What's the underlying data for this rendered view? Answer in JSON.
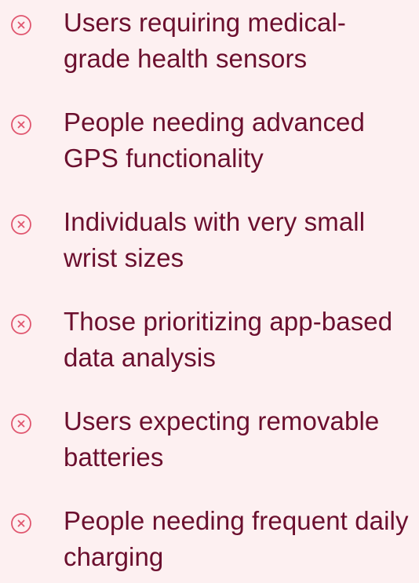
{
  "list": {
    "icon": "x-circle-icon",
    "icon_color": "#e0566f",
    "text_color": "#6b0f2e",
    "items": [
      {
        "line1": "Users requiring medical-",
        "line2": "grade health sensors"
      },
      {
        "line1": "People needing advanced",
        "line2": "GPS functionality"
      },
      {
        "line1": "Individuals with very small",
        "line2": "wrist sizes"
      },
      {
        "line1": "Those prioritizing app-based",
        "line2": "data analysis"
      },
      {
        "line1": "Users expecting removable",
        "line2": "batteries"
      },
      {
        "line1": "People needing frequent daily",
        "line2": "charging"
      }
    ]
  }
}
